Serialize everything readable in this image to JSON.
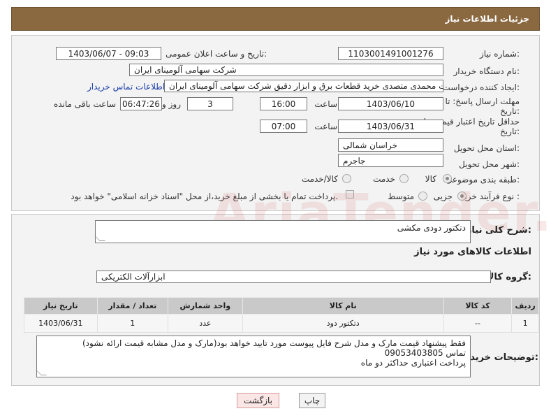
{
  "header": {
    "title": "جزئیات اطلاعات نیاز"
  },
  "need_number": {
    "label": "شماره نیاز:",
    "value": "1103001491001276"
  },
  "announce_datetime": {
    "label": "تاریخ و ساعت اعلان عمومی:",
    "value": "1403/06/07 - 09:03"
  },
  "buyer_org": {
    "label": "نام دستگاه خریدار:",
    "value": "شرکت سهامی آلومینای ایران"
  },
  "requester": {
    "label": "ایجاد کننده درخواست:",
    "value": "سجاد دوست محمدی متصدی خرید قطعات برق و ابزار دقیق شرکت سهامی آلومینای ایران",
    "contact_link": "اطلاعات تماس خریدار"
  },
  "reply_deadline": {
    "label_line1": "مهلت ارسال پاسخ: تا",
    "label_line2": "تاریخ:",
    "date": "1403/06/10",
    "time_label": "ساعت",
    "time": "16:00",
    "days": "3",
    "days_label": "روز و",
    "remaining": "06:47:26",
    "remaining_label": "ساعت باقی مانده"
  },
  "price_validity": {
    "label_line1": "حداقل تاریخ اعتبار قیمت: تا",
    "label_line2": "تاریخ:",
    "date": "1403/06/31",
    "time_label": "ساعت",
    "time": "07:00"
  },
  "delivery_province": {
    "label": "استان محل تحویل:",
    "value": "خراسان شمالی"
  },
  "delivery_city": {
    "label": "شهر محل تحویل:",
    "value": "جاجرم"
  },
  "category": {
    "label": "طبقه بندی موضوعی:",
    "options": [
      "کالا",
      "خدمت",
      "کالا/خدمت"
    ]
  },
  "process_type": {
    "label": "نوع فرآیند خرید :",
    "options": [
      "جزیی",
      "متوسط"
    ],
    "note": "پرداخت تمام یا بخشی از مبلغ خرید،از محل \"اسناد خزانه اسلامی\" خواهد بود."
  },
  "watermark": "AriaTender.neT",
  "general_desc": {
    "label": "شرح کلی نیاز:",
    "value": "دتکتور دودی مکشی"
  },
  "goods_info_title": "اطلاعات کالاهای مورد نیاز",
  "goods_group": {
    "label": "گروه کالا:",
    "value": "ابزارآلات الکتریکی"
  },
  "table": {
    "headers": [
      "ردیف",
      "کد کالا",
      "نام کالا",
      "واحد شمارش",
      "تعداد / مقدار",
      "تاریخ نیاز"
    ],
    "rows": [
      [
        "1",
        "--",
        "دتکتور دود",
        "عدد",
        "1",
        "1403/06/31"
      ]
    ]
  },
  "buyer_notes": {
    "label": "توضیحات خریدار:",
    "line1": "فقط پیشنهاد قیمت مارک و مدل شرح فایل پیوست مورد تایید خواهد بود(مارک و مدل مشابه قیمت ارائه نشود)",
    "line2": "تماس 09053403805",
    "line3": "پرداخت اعتباری حداکثر دو ماه"
  },
  "buttons": {
    "print": "چاپ",
    "back": "بازگشت"
  }
}
